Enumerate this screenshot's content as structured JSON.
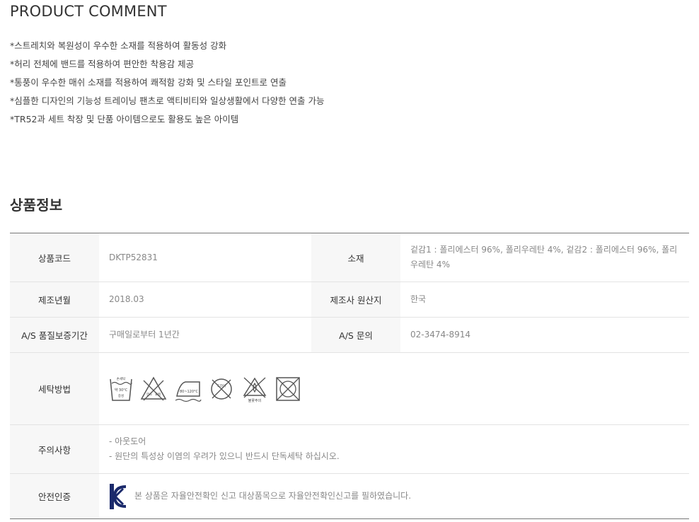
{
  "product_comment": {
    "title": "PRODUCT COMMENT",
    "items": [
      "*스트레치와 복원성이 우수한 소재를 적용하여 활동성 강화",
      "*허리 전체에 밴드를 적용하여 편안한 착용감 제공",
      "*통풍이 우수한 매쉬 소재를 적용하여 쾌적함 강화 및 스타일 포인트로 연출",
      "*심플한 디자인의 기능성 트레이닝 팬츠로 액티비티와 일상생활에서 다양한 연출 가능",
      "*TR52과 세트 착장 및 단품 아이템으로도 활용도 높은 아이템"
    ]
  },
  "product_info": {
    "title": "상품정보",
    "product_code_label": "상품코드",
    "product_code": "DKTP52831",
    "material_label": "소재",
    "material": "겉감1 : 폴리에스터 96%, 폴리우레탄 4%, 겉감2 : 폴리에스터 96%, 폴리우레탄 4%",
    "mfg_date_label": "제조년월",
    "mfg_date": "2018.03",
    "origin_label": "제조사 원산지",
    "origin": "한국",
    "warranty_label": "A/S 품질보증기간",
    "warranty": "구매일로부터 1년간",
    "as_contact_label": "A/S 문의",
    "as_contact": "02-3474-8914",
    "washing_label": "세탁방법",
    "washing_icons": [
      {
        "icon": "hand-wash-30c-icon",
        "texts": [
          "손세탁",
          "약 30°C",
          "중성"
        ]
      },
      {
        "icon": "no-bleach-icon",
        "texts": [
          "염소",
          "표백"
        ]
      },
      {
        "icon": "iron-80-120c-icon",
        "texts": [
          "80~120°C"
        ]
      },
      {
        "icon": "no-dry-clean-icon",
        "texts": [
          "드라이"
        ]
      },
      {
        "icon": "no-tumble-dry-icon",
        "texts": [
          "불꽃주의"
        ]
      },
      {
        "icon": "no-machine-dry-icon",
        "texts": []
      }
    ],
    "caution_label": "주의사항",
    "cautions": [
      "- 아웃도어",
      "- 원단의 특성상 이염의 우려가 있으니 반드시 단독세탁 하십시오."
    ],
    "safety_label": "안전인증",
    "safety_text": "본 상품은 자율안전확인 신고 대상품목으로 자율안전확인신고를 필하였습니다.",
    "kc_mark": "KC"
  }
}
